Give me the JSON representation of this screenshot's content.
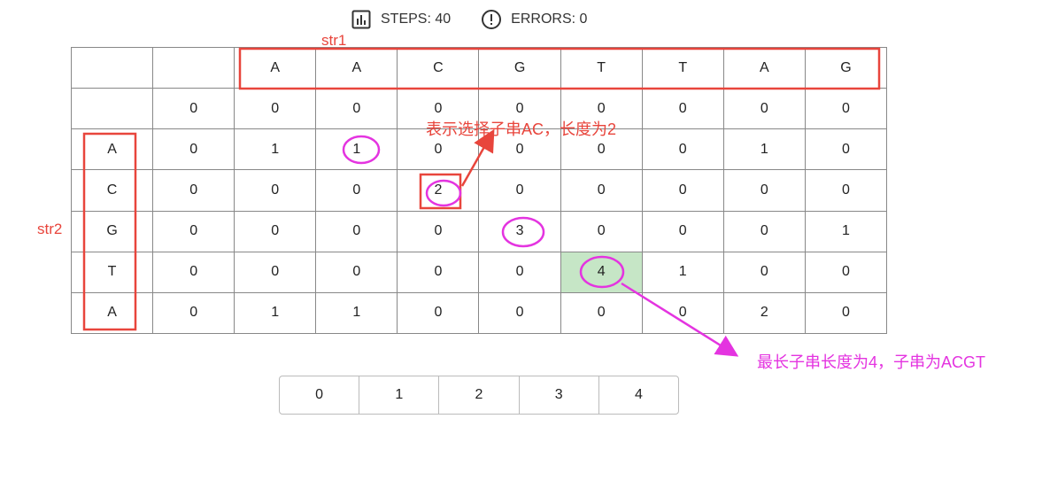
{
  "stats": {
    "steps_label": "STEPS: 40",
    "errors_label": "ERRORS: 0",
    "steps_icon": "bar-chart-icon",
    "errors_icon": "alert-circle-icon"
  },
  "annotations": {
    "str1_label": "str1",
    "str2_label": "str2",
    "note_ac": "表示选择子串AC，长度为2",
    "note_acgt": "最长子串长度为4，子串为ACGT",
    "red_color": "#e8453c",
    "magenta_color": "#e434e0"
  },
  "table": {
    "rows": [
      [
        "",
        "",
        "A",
        "A",
        "C",
        "G",
        "T",
        "T",
        "A",
        "G"
      ],
      [
        "",
        "0",
        "0",
        "0",
        "0",
        "0",
        "0",
        "0",
        "0",
        "0"
      ],
      [
        "A",
        "0",
        "1",
        "1",
        "0",
        "0",
        "0",
        "0",
        "1",
        "0"
      ],
      [
        "C",
        "0",
        "0",
        "0",
        "2",
        "0",
        "0",
        "0",
        "0",
        "0"
      ],
      [
        "G",
        "0",
        "0",
        "0",
        "0",
        "3",
        "0",
        "0",
        "0",
        "1"
      ],
      [
        "T",
        "0",
        "0",
        "0",
        "0",
        "0",
        "4",
        "1",
        "0",
        "0"
      ],
      [
        "A",
        "0",
        "1",
        "1",
        "0",
        "0",
        "0",
        "0",
        "2",
        "0"
      ]
    ],
    "highlight_color": "#c6e6c6"
  },
  "pagination": {
    "pages": [
      "0",
      "1",
      "2",
      "3",
      "4"
    ]
  }
}
